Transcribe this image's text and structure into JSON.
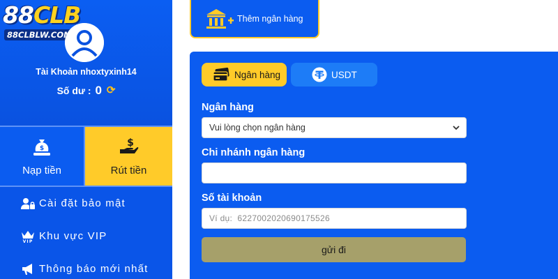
{
  "brand": {
    "logo_main_a": "88",
    "logo_main_b": "CLB",
    "logo_sub": "88CLBLW.COM"
  },
  "profile": {
    "account_label": "Tài Khoản nhoxtyxinh14",
    "balance_label": "Số dư :",
    "balance_value": "0"
  },
  "tiles": {
    "deposit_label": "Nạp tiền",
    "withdraw_label": "Rút tiền"
  },
  "menu": {
    "items": [
      {
        "label": "Cài đặt bảo mật",
        "icon": "user-lock-icon"
      },
      {
        "label": "Khu vực VIP",
        "icon": "vip-crown-icon"
      },
      {
        "label": "Thông báo mới nhất",
        "icon": "megaphone-icon"
      }
    ]
  },
  "top_tab": {
    "add_bank_label": "Thêm ngân hàng"
  },
  "payment_types": {
    "bank_label": "Ngân hàng",
    "usdt_label": "USDT"
  },
  "form": {
    "bank_label": "Ngân hàng",
    "bank_select_value": "Vui lòng chọn ngân hàng",
    "branch_label": "Chi nhánh ngân hàng",
    "branch_value": "",
    "account_number_label": "Số tài khoản",
    "account_number_placeholder": "Ví dụ:  6227002020690175526",
    "submit_label": "gửi đi"
  },
  "colors": {
    "primary_blue": "#0b5cf0",
    "accent_yellow": "#ffcb29",
    "submit_olive": "#a6a06a",
    "usdt_blue": "#1d7cf7"
  }
}
